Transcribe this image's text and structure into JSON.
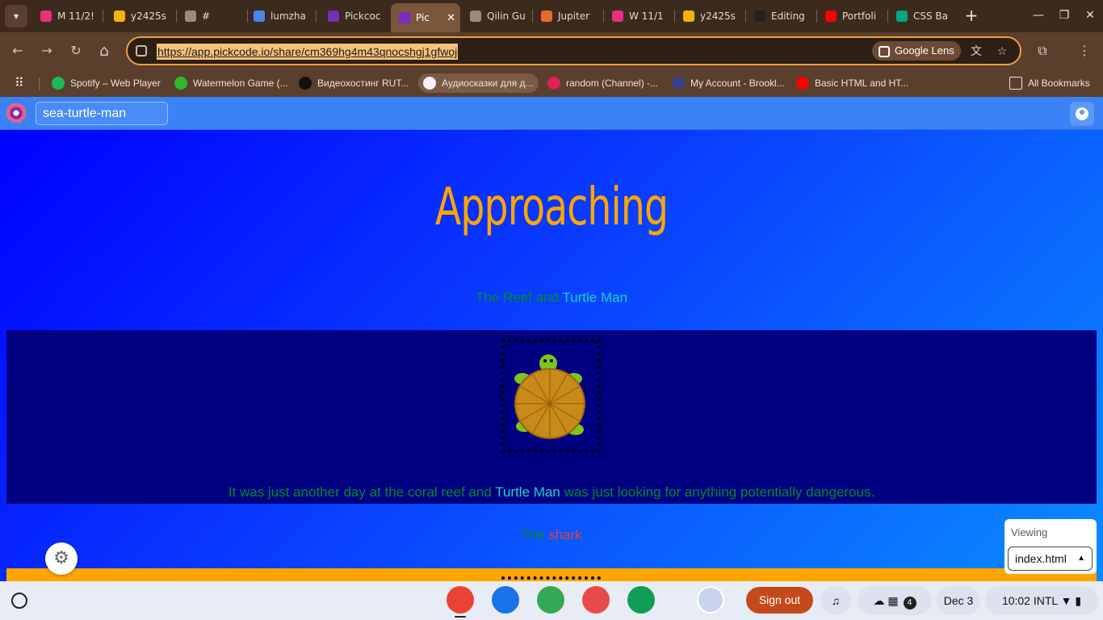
{
  "tabs": [
    {
      "title": "M 11/2!",
      "color": "#e8317a"
    },
    {
      "title": "y2425s",
      "color": "#f4b400"
    },
    {
      "title": "#",
      "color": "#9a8a80"
    },
    {
      "title": "lumzha",
      "color": "#4a86e8"
    },
    {
      "title": "Pickcoc",
      "color": "#7b2cbf"
    },
    {
      "title": "Pic",
      "color": "#7b2cbf"
    },
    {
      "title": "Qilin Gu",
      "color": "#9a8a80"
    },
    {
      "title": "Jupiter",
      "color": "#e86a2c"
    },
    {
      "title": "W 11/1",
      "color": "#e8317a"
    },
    {
      "title": "y2425s",
      "color": "#f4b400"
    },
    {
      "title": "Editing",
      "color": "#222222"
    },
    {
      "title": "Portfoli",
      "color": "#ff0000"
    },
    {
      "title": "CSS Ba",
      "color": "#00a884"
    }
  ],
  "active_tab_close": "✕",
  "new_tab": "+",
  "window_controls": {
    "minimize": "—",
    "maximize": "❐",
    "close": "✕"
  },
  "toolbar": {
    "back_icon": "←",
    "forward_icon": "→",
    "reload_icon": "↻",
    "home_icon": "⌂",
    "url": "https://app.pickcode.io/share/cm369hg4m43qnocshgj1gfwoj",
    "lens_label": "Google Lens",
    "translate_icon": "文",
    "star_icon": "☆",
    "extensions_icon": "⧉",
    "menu_icon": "⋮"
  },
  "bookmarks": {
    "apps_icon": "⠿",
    "items": [
      {
        "label": "Spotify – Web Player",
        "color": "#1db954"
      },
      {
        "label": "Watermelon Game (...",
        "color": "#2eb82e"
      },
      {
        "label": "Видеохостинг RUT...",
        "color": "#111111"
      },
      {
        "label": "Аудиосказки для д...",
        "color": "#f5f0ff"
      },
      {
        "label": "random (Channel) -...",
        "color": "#e01e5a"
      },
      {
        "label": "My Account - Brookl...",
        "color": "#3b3b8c"
      },
      {
        "label": "Basic HTML and HT...",
        "color": "#ff0000"
      }
    ],
    "all_bookmarks": "All Bookmarks"
  },
  "pickcode": {
    "project_name": "sea-turtle-man"
  },
  "page": {
    "heading": "Approaching",
    "subtitle_part1": "The Reef and ",
    "subtitle_part2": "Turtle Man",
    "story_part1": "It was just another day at the coral reef and ",
    "story_part2": "Turtle Man",
    "story_part3": " was just looking for anything potentially dangerous.",
    "shark_part1": "The ",
    "shark_part2": "shark"
  },
  "viewer": {
    "label": "Viewing",
    "file": "index.html",
    "settings_icon": "⚙"
  },
  "shelf": {
    "apps": [
      {
        "name": "chrome",
        "color": "#ea4335"
      },
      {
        "name": "files",
        "color": "#1a73e8"
      },
      {
        "name": "play-store",
        "color": "#34a853"
      },
      {
        "name": "canvas",
        "color": "#e84a4a"
      },
      {
        "name": "classroom",
        "color": "#0f9d58"
      }
    ],
    "sign_out": "Sign out",
    "notification_count": "4",
    "date": "Dec 3",
    "time": "10:02",
    "ime": "INTL"
  },
  "colors": {
    "heading": "#ffa500",
    "green_text": "#008a2e",
    "aqua_text": "#19d3c5",
    "shark_text": "#e04040",
    "reef_band": "#000080",
    "orange_band": "#ffa500"
  }
}
